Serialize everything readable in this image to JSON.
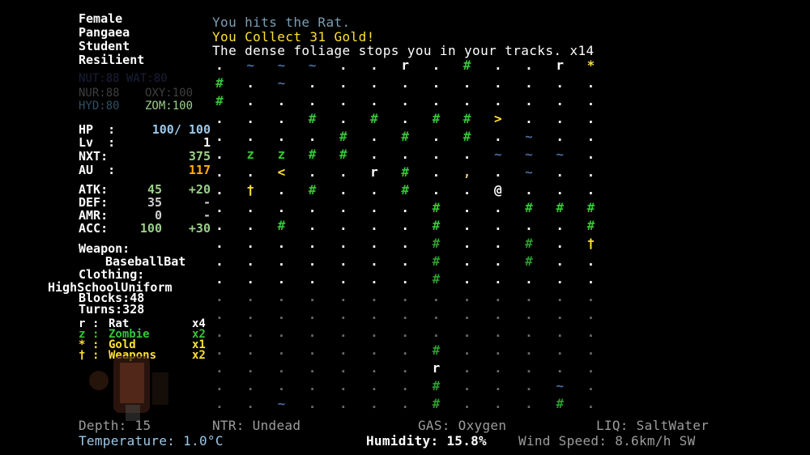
{
  "colors": {
    "white": "#ffffff",
    "gray": "#cfcfcf",
    "yellow": "#ffe033",
    "green": "#37c437",
    "cyan": "#9ec8e8",
    "teal": "#7a9fb5",
    "dim": "#3a3a3a",
    "pink": "#b45cb4",
    "blue": "#2c2c8c"
  },
  "profile": {
    "gender": "Female",
    "world": "Pangaea",
    "job": "Student",
    "trait": "Resilient"
  },
  "needs": {
    "row0": "NUT:88 WAT:80",
    "nur": "NUR:88",
    "oxy": "OXY:100",
    "hyd": "HYD:80",
    "zom": "ZOM:100"
  },
  "stats": {
    "hp_label": "HP  :",
    "hp_value": "100/ 100",
    "lv_label": "Lv  :",
    "lv_value": "1",
    "nxt_label": "NXT:",
    "nxt_value": "375",
    "au_label": "AU  :",
    "au_value": "117",
    "atk_label": "ATK:",
    "atk_value": "45",
    "atk_bonus": "+20",
    "def_label": "DEF:",
    "def_value": "35",
    "def_bonus": "-",
    "amr_label": "AMR:",
    "amr_value": "0",
    "amr_bonus": "-",
    "acc_label": "ACC:",
    "acc_value": "100",
    "acc_bonus": "+30"
  },
  "equipment": {
    "weapon_label": "Weapon:",
    "weapon": "BaseballBat",
    "clothing_label": "Clothing:",
    "clothing": "HighSchoolUniform",
    "blocks": "Blocks:48",
    "turns": "Turns:328"
  },
  "legend": [
    {
      "glyph": "r",
      "sep": ":",
      "name": "Rat",
      "count": "x4",
      "color": "#ffffff"
    },
    {
      "glyph": "z",
      "sep": ":",
      "name": "Zombie",
      "count": "x2",
      "color": "#37c437"
    },
    {
      "glyph": "*",
      "sep": ":",
      "name": "Gold",
      "count": "x1",
      "color": "#ffe033"
    },
    {
      "glyph": "†",
      "sep": ":",
      "name": "Weapons",
      "count": "x2",
      "color": "#ffe033"
    }
  ],
  "messages": [
    {
      "text": "You hits the Rat.",
      "color": "#7a9fb5"
    },
    {
      "text": "You Collect 31 Gold!",
      "color": "#ffe033"
    },
    {
      "text": "The dense foliage stops you in your tracks. x14",
      "color": "#ffffff"
    }
  ],
  "status": {
    "depth": "Depth: 15",
    "ntr": "NTR: Undead",
    "gas": "GAS: Oxygen",
    "liq": "LIQ: SaltWater",
    "temperature": "Temperature: 1.0°C",
    "humidity": "Humidity: 15.8%",
    "wind": "Wind Speed: 8.6km/h SW"
  },
  "map": {
    "rows": [
      ". ~ ~ ~ . . r . # . . r *",
      "# . ~ . . . . . . . . . .",
      "# . . . . . . . . . . . .",
      ". . . # . # . # # > . . .",
      ". . . . # . # . # . ~ . .",
      ". z z # # . . . . ~ ~ ~ .",
      ". . < . . r # . , . ~ . .",
      ". † . # . . # . . @ . . .",
      ". . . . . . . # . . # # #",
      ". . # . . . . # . . . . #",
      ". . . . . . . # . . # . †",
      ". . . . . . . # . . # . .",
      ". . . . . . . # . . . . .",
      ". . . . . . . . . . . . .",
      ". . . . . . . . . . . . .",
      ". . . . . . . . . . . . .",
      ". . . . . . . # . . . . .",
      ". . . . . . . r . . . . .",
      ". . . . . . . # . . . ~ .",
      ". . ~ . . . . # . . . # ."
    ]
  }
}
